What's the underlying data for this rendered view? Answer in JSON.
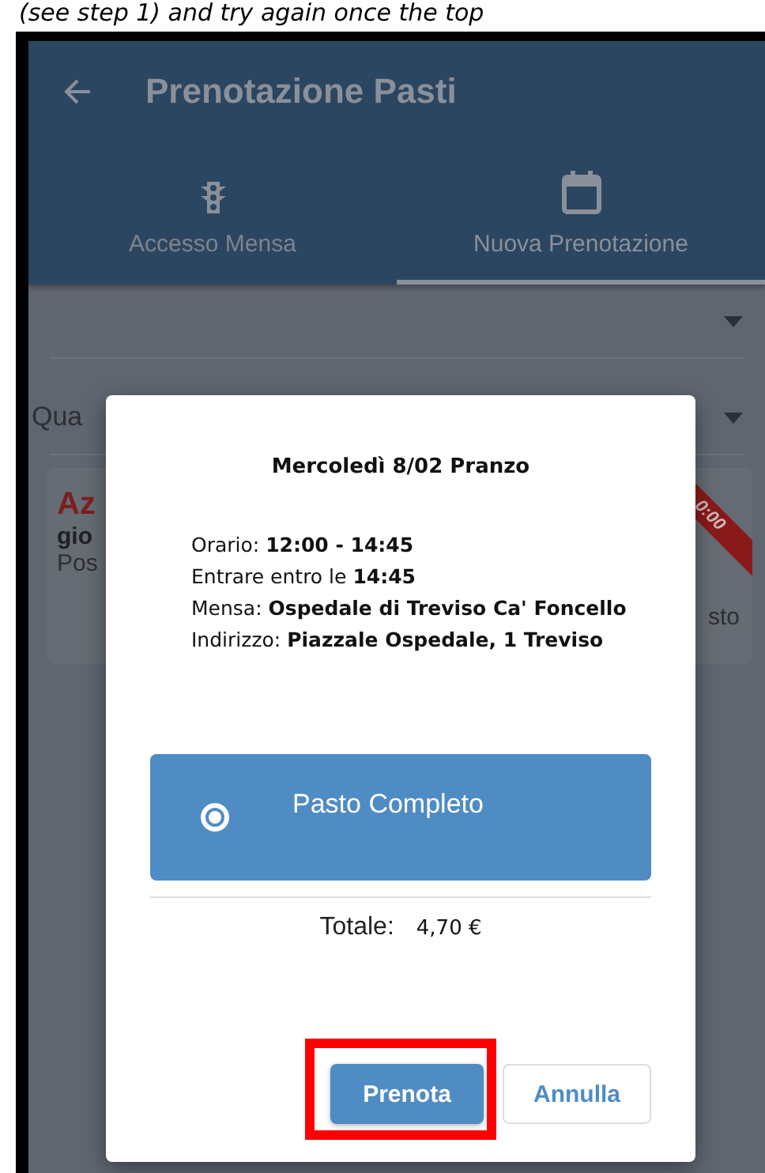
{
  "caption": "(see step 1) and try again once the top",
  "app_bar": {
    "title": "Prenotazione Pasti"
  },
  "tabs": [
    {
      "label": "Accesso Mensa",
      "selected": false
    },
    {
      "label": "Nuova Prenotazione",
      "selected": true
    }
  ],
  "dropdowns": [
    {
      "kind": "blank"
    },
    {
      "kind": "text",
      "value": "Qua"
    }
  ],
  "card": {
    "title": "Az",
    "subtitle": "gio",
    "line": "Pos",
    "right_text": "sto",
    "ribbon": "0:00"
  },
  "dialog": {
    "title": "Mercoledì 8/02 Pranzo",
    "details": [
      "Orario: **12:00 - 14:45**",
      "Entrare entro le **14:45**",
      "Mensa: **Ospedale di Treviso Ca' Foncello**",
      "Indirizzo: **Piazzale Ospedale, 1 Treviso**"
    ],
    "options": [
      {
        "label": "Pasto Completo",
        "selected": true
      }
    ],
    "total_label": "Totale:",
    "total_value": "4,70 €",
    "buttons": [
      {
        "label": "Prenota",
        "kind": "primary",
        "highlighted": true
      },
      {
        "label": "Annulla",
        "kind": "secondary",
        "highlighted": false
      }
    ]
  }
}
